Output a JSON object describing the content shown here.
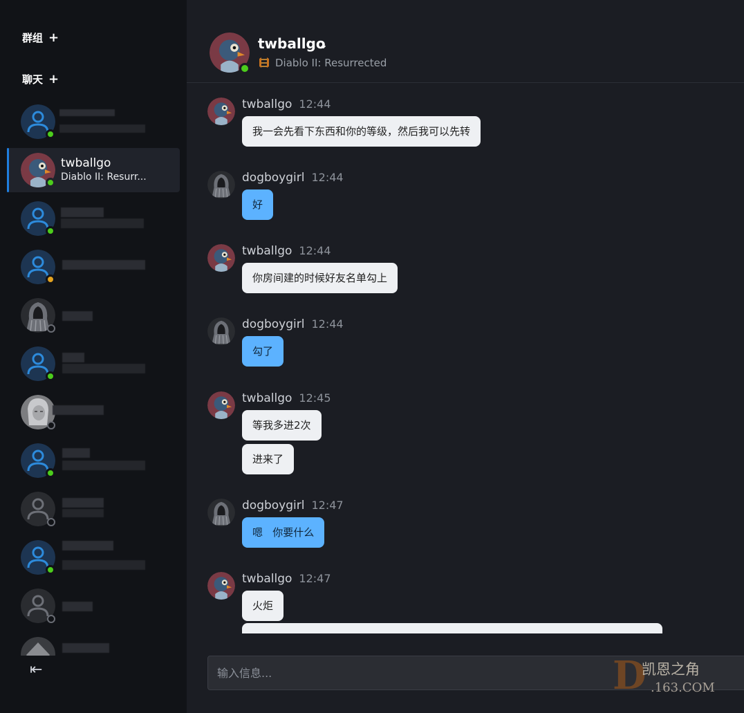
{
  "sidebar": {
    "groups_label": "群组",
    "chats_label": "聊天",
    "plus_glyph": "+",
    "collapse_glyph": "⇤",
    "contacts": [
      {
        "name": "",
        "status": "online",
        "avatar": "default-user-icon"
      },
      {
        "name": "twballgo",
        "game": "Diablo II: Resurr...",
        "status": "online",
        "avatar": "puffin-avatar",
        "active": true
      },
      {
        "name": "",
        "status": "online",
        "avatar": "default-user-icon"
      },
      {
        "name": "",
        "status": "away",
        "avatar": "default-user-icon"
      },
      {
        "name": "",
        "status": "offline",
        "avatar": "hooded-figure-avatar"
      },
      {
        "name": "",
        "status": "online",
        "avatar": "default-user-icon"
      },
      {
        "name": "",
        "status": "offline",
        "avatar": "female-portrait-avatar"
      },
      {
        "name": "",
        "status": "online",
        "avatar": "default-user-icon"
      },
      {
        "name": "",
        "status": "offline",
        "avatar": "default-user-icon-grey"
      },
      {
        "name": "",
        "status": "online",
        "avatar": "default-user-icon"
      },
      {
        "name": "",
        "status": "offline",
        "avatar": "default-user-icon-grey"
      },
      {
        "name": "",
        "status": "unknown",
        "avatar": "dark-creature-avatar"
      }
    ]
  },
  "header": {
    "name": "twballgo",
    "chevron": "⌄",
    "game": "Diablo II: Resurrected",
    "game_icon": "diablo-game-icon",
    "status": "online"
  },
  "messages": [
    {
      "author": "twballgo",
      "time": "12:44",
      "avatar": "puffin-avatar",
      "bubbles": [
        "我一会先看下东西和你的等级，然后我可以先转"
      ],
      "side": "in"
    },
    {
      "author": "dogboygirl",
      "time": "12:44",
      "avatar": "hooded-figure-avatar",
      "bubbles": [
        "好"
      ],
      "side": "out"
    },
    {
      "author": "twballgo",
      "time": "12:44",
      "avatar": "puffin-avatar",
      "bubbles": [
        "你房间建的时候好友名单勾上"
      ],
      "side": "in"
    },
    {
      "author": "dogboygirl",
      "time": "12:44",
      "avatar": "hooded-figure-avatar",
      "bubbles": [
        "勾了"
      ],
      "side": "out"
    },
    {
      "author": "twballgo",
      "time": "12:45",
      "avatar": "puffin-avatar",
      "bubbles": [
        "等我多进2次",
        "进来了"
      ],
      "side": "in"
    },
    {
      "author": "dogboygirl",
      "time": "12:47",
      "avatar": "hooded-figure-avatar",
      "bubbles": [
        "嗯   你要什么"
      ],
      "side": "out"
    },
    {
      "author": "twballgo",
      "time": "12:47",
      "avatar": "puffin-avatar",
      "bubbles": [
        "火炬"
      ],
      "side": "in"
    }
  ],
  "input": {
    "placeholder": "输入信息..."
  },
  "watermark": {
    "letter": "D",
    "line1": "凯恩之角",
    "line2": ".163.COM"
  },
  "colors": {
    "online": "#4ccd1c",
    "away": "#e4a320",
    "accent": "#1f7fe0",
    "own_bubble": "#5cb2ff",
    "other_bubble": "#eef0f3"
  }
}
